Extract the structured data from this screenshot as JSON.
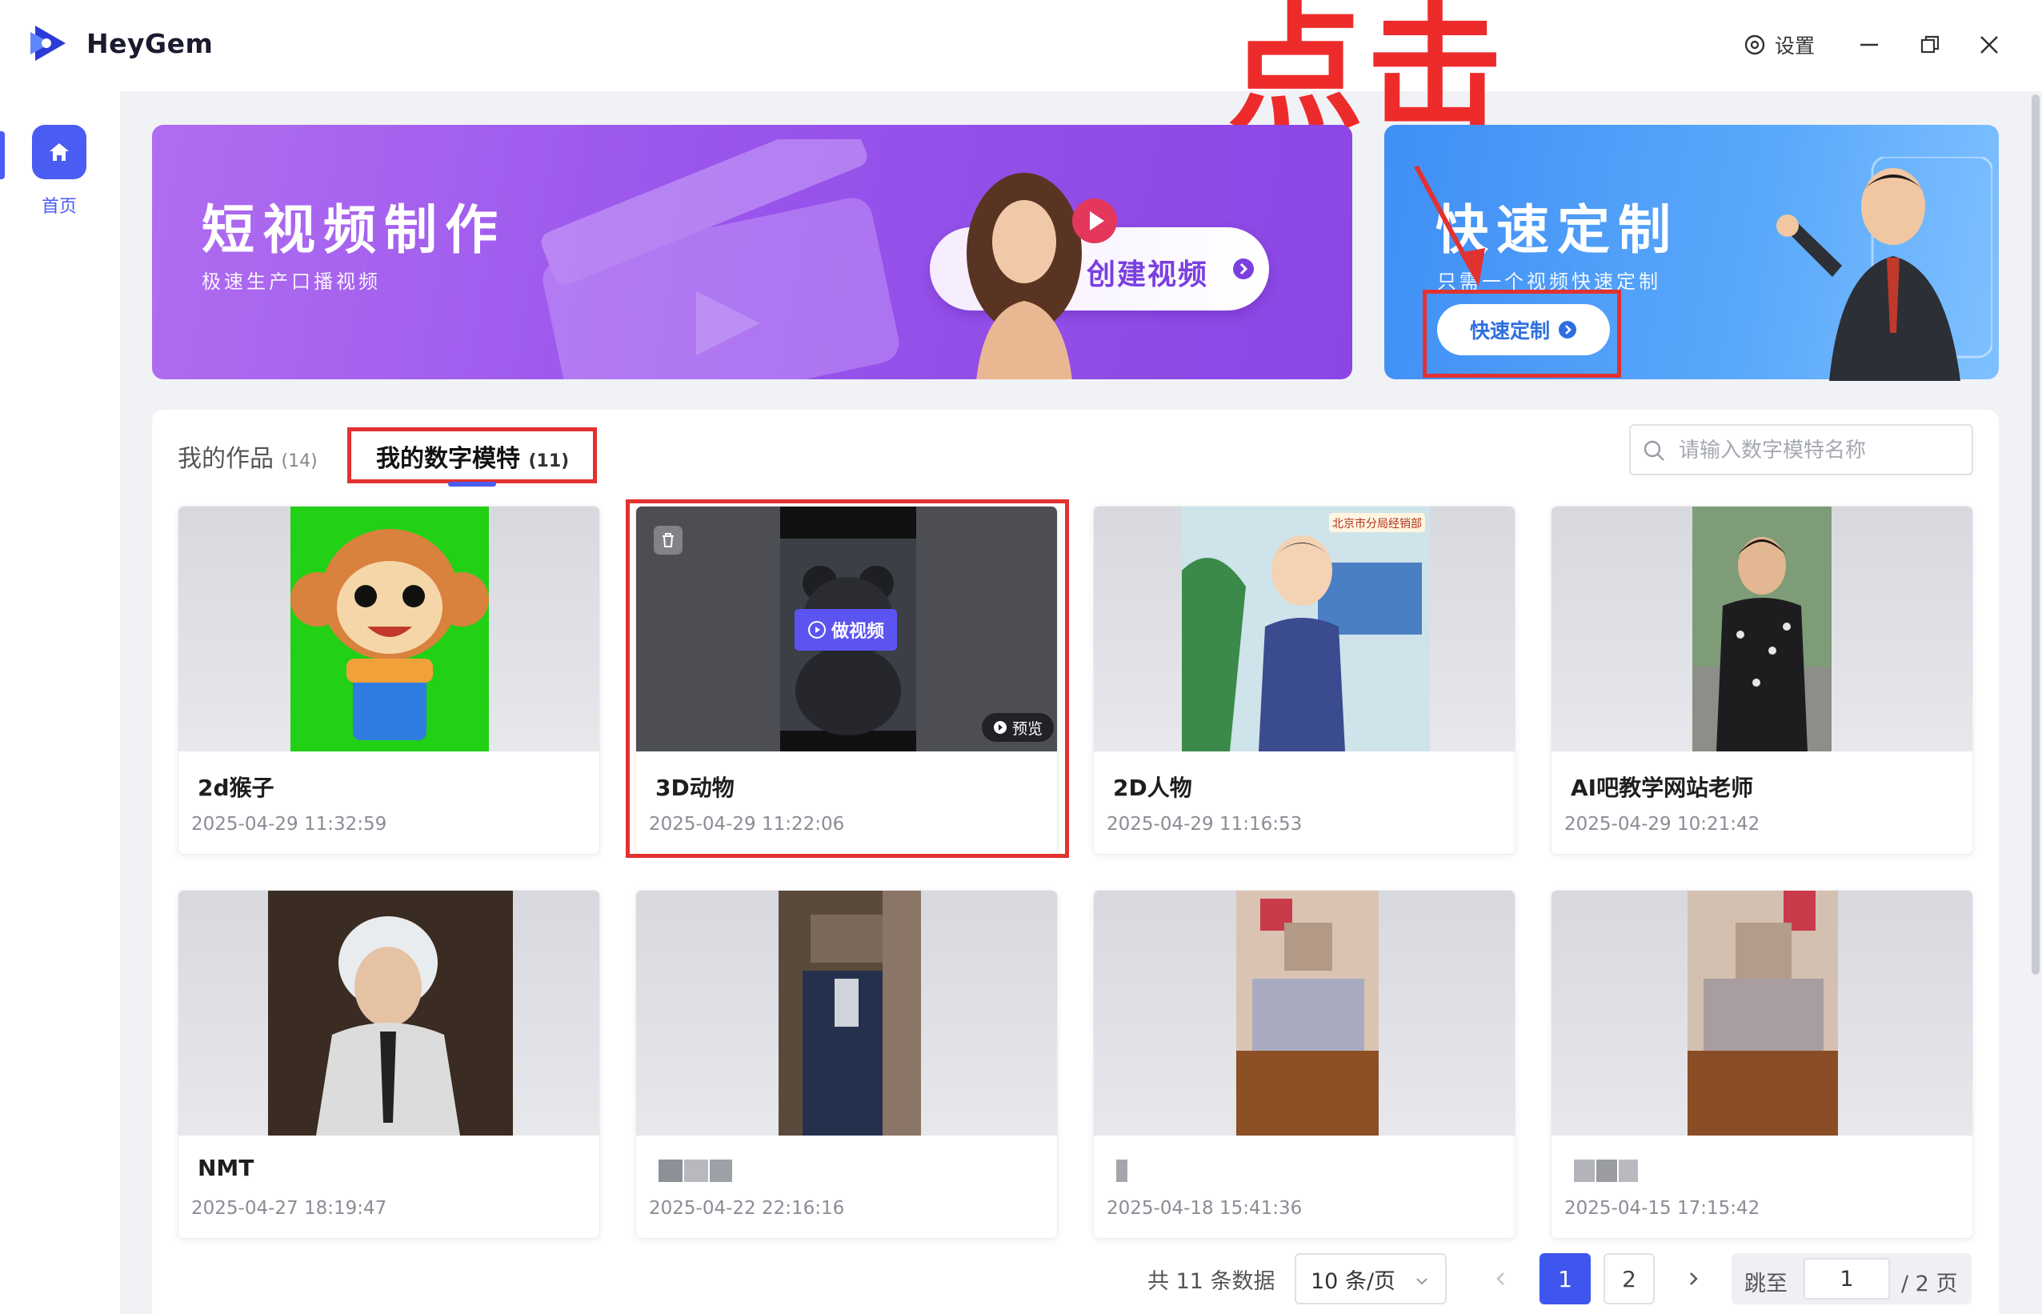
{
  "app": {
    "name": "HeyGem"
  },
  "annotation": {
    "click_text": "点击"
  },
  "window": {
    "settings_label": "设置"
  },
  "sidebar": {
    "home_label": "首页"
  },
  "banners": {
    "video": {
      "title": "短视频制作",
      "subtitle": "极速生产口播视频",
      "button_label": "创建视频"
    },
    "quick": {
      "title": "快速定制",
      "subtitle": "只需一个视频快速定制",
      "button_label": "快速定制"
    }
  },
  "tabs": {
    "works": {
      "label": "我的作品",
      "count": "(14)"
    },
    "models": {
      "label": "我的数字模特",
      "count": "(11)"
    }
  },
  "search": {
    "placeholder": "请输入数字模特名称"
  },
  "cards": [
    {
      "name": "2d猴子",
      "date": "2025-04-29 11:32:59"
    },
    {
      "name": "3D动物",
      "date": "2025-04-29 11:22:06",
      "make_label": "做视频",
      "preview_label": "预览"
    },
    {
      "name": "2D人物",
      "date": "2025-04-29 11:16:53",
      "sign_text": "北京市分局经销部"
    },
    {
      "name": "AI吧教学网站老师",
      "date": "2025-04-29 10:21:42"
    },
    {
      "name": "NMT",
      "date": "2025-04-27 18:19:47"
    },
    {
      "name": "",
      "date": "2025-04-22 22:16:16"
    },
    {
      "name": "",
      "date": "2025-04-18 15:41:36"
    },
    {
      "name": "",
      "date": "2025-04-15 17:15:42"
    }
  ],
  "pagination": {
    "total_text": "共 11 条数据",
    "page_size": "10 条/页",
    "pages": [
      "1",
      "2"
    ],
    "current_page": "1",
    "jump_label": "跳至",
    "jump_value": "1",
    "total_pages_text": "/ 2 页"
  },
  "colors": {
    "accent": "#4a5cf2",
    "annotation": "#e23131",
    "video_banner": "#9a55ec",
    "quick_banner": "#4a9af7"
  }
}
